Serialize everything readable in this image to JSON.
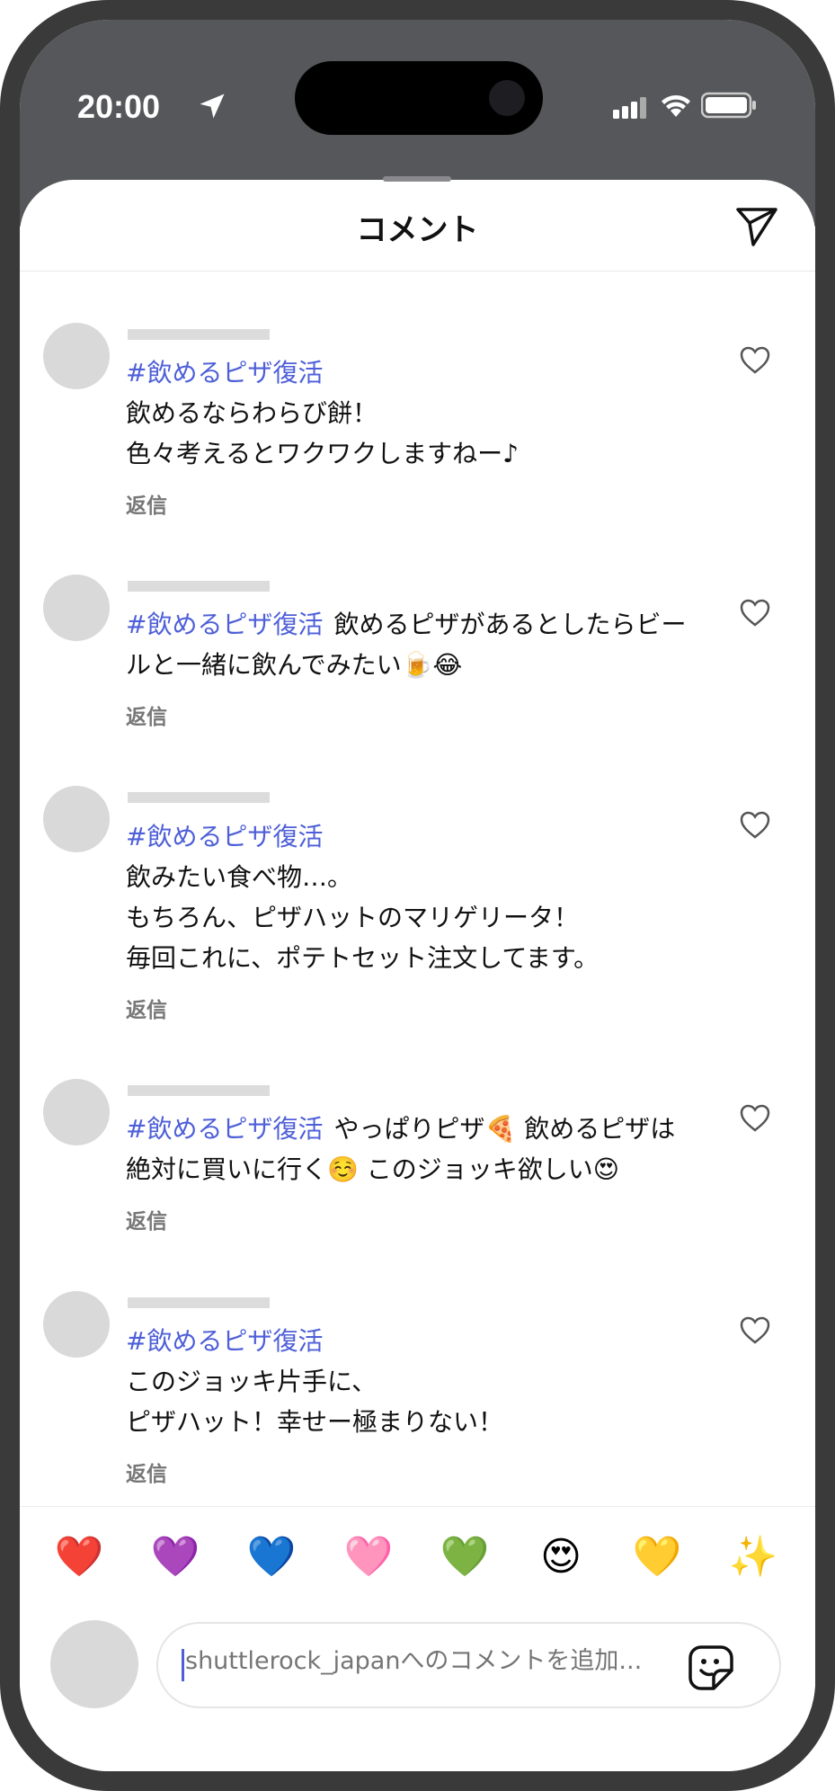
{
  "status": {
    "time": "20:00"
  },
  "header": {
    "title": "コメント"
  },
  "comments": [
    {
      "tag": "#飲めるピザ復活",
      "text_lines": [
        "飲めるならわらび餅！",
        "色々考えるとワクワクしますねー♪"
      ],
      "inline": "",
      "reply": "返信"
    },
    {
      "tag": "#飲めるピザ復活",
      "inline": "飲めるピザがあるとしたらビールと一緒に飲んでみたい🍺😂",
      "text_lines": [],
      "reply": "返信"
    },
    {
      "tag": "#飲めるピザ復活",
      "text_lines": [
        "飲みたい食べ物…。",
        "もちろん、ピザハットのマリゲリータ！",
        "毎回これに、ポテトセット注文してます。"
      ],
      "inline": "",
      "reply": "返信"
    },
    {
      "tag": "#飲めるピザ復活",
      "inline": "やっぱりピザ🍕 飲めるピザは絶対に買いに行く☺️ このジョッキ欲しい😍",
      "text_lines": [],
      "reply": "返信"
    },
    {
      "tag": "#飲めるピザ復活",
      "text_lines": [
        "このジョッキ片手に、",
        "ピザハット！幸せー極まりない！"
      ],
      "inline": "",
      "reply": "返信"
    }
  ],
  "emoji_bar": [
    "❤️",
    "💜",
    "💙",
    "🩷",
    "💚",
    "😍",
    "💛",
    "✨"
  ],
  "composer": {
    "placeholder": "shuttlerock_japanへのコメントを追加..."
  },
  "icons": {
    "send": "paper-plane-icon",
    "heart": "heart-outline-icon",
    "sticker": "sticker-icon"
  }
}
